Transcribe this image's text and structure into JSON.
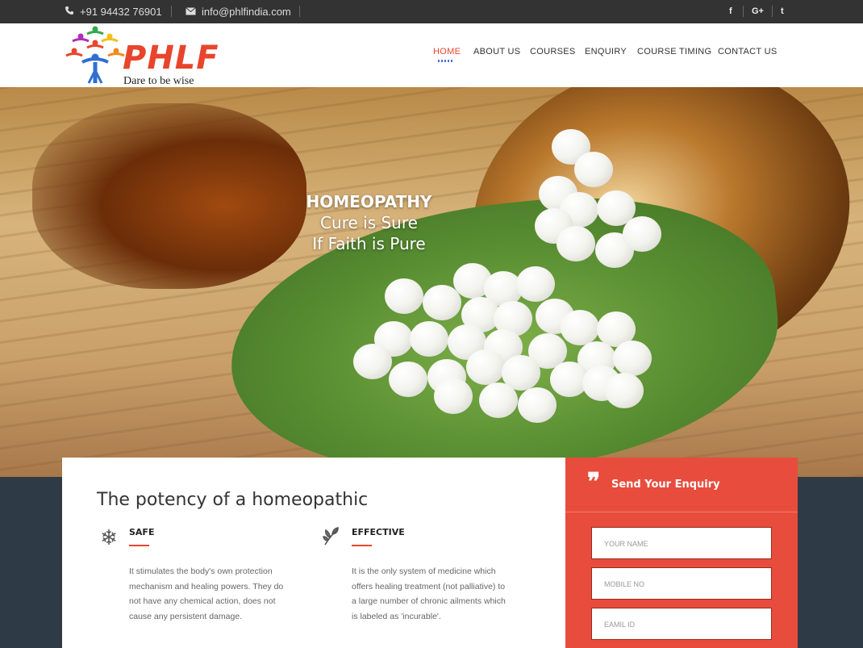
{
  "topbar": {
    "phone": "+91 94432 76901",
    "email": "info@phlfindia.com",
    "social": [
      "f",
      "G+",
      "t"
    ]
  },
  "logo": {
    "name": "PHLF",
    "tagline": "Dare to be wise"
  },
  "nav": {
    "items": [
      "HOME",
      "ABOUT US",
      "COURSES",
      "ENQUIRY",
      "COURSE TIMING",
      "CONTACT US"
    ],
    "active": "HOME"
  },
  "hero": {
    "title": "HOMEOPATHY",
    "line2": "Cure is Sure",
    "line3": "If Faith is Pure"
  },
  "content": {
    "heading": "The potency of a homeopathic",
    "features": [
      {
        "title": "SAFE",
        "icon": "snowflake-icon",
        "description": "It stimulates the body's own protection mechanism and healing powers. They do not have any chemical action, does not cause any persistent damage."
      },
      {
        "title": "EFFECTIVE",
        "icon": "leaf-icon",
        "description": "It is the only system of medicine which offers healing treatment (not palliative) to a large number of chronic ailments which is labeled as 'incurable'."
      }
    ]
  },
  "enquiry": {
    "title": "Send Your Enquiry",
    "fields": [
      "YOUR NAME",
      "MOBILE NO",
      "EAMIL ID"
    ]
  },
  "colors": {
    "accent": "#e8452c",
    "topbar": "#333333",
    "enquiry_bg": "#e84c3d",
    "footer_bg": "#2f3a47"
  }
}
